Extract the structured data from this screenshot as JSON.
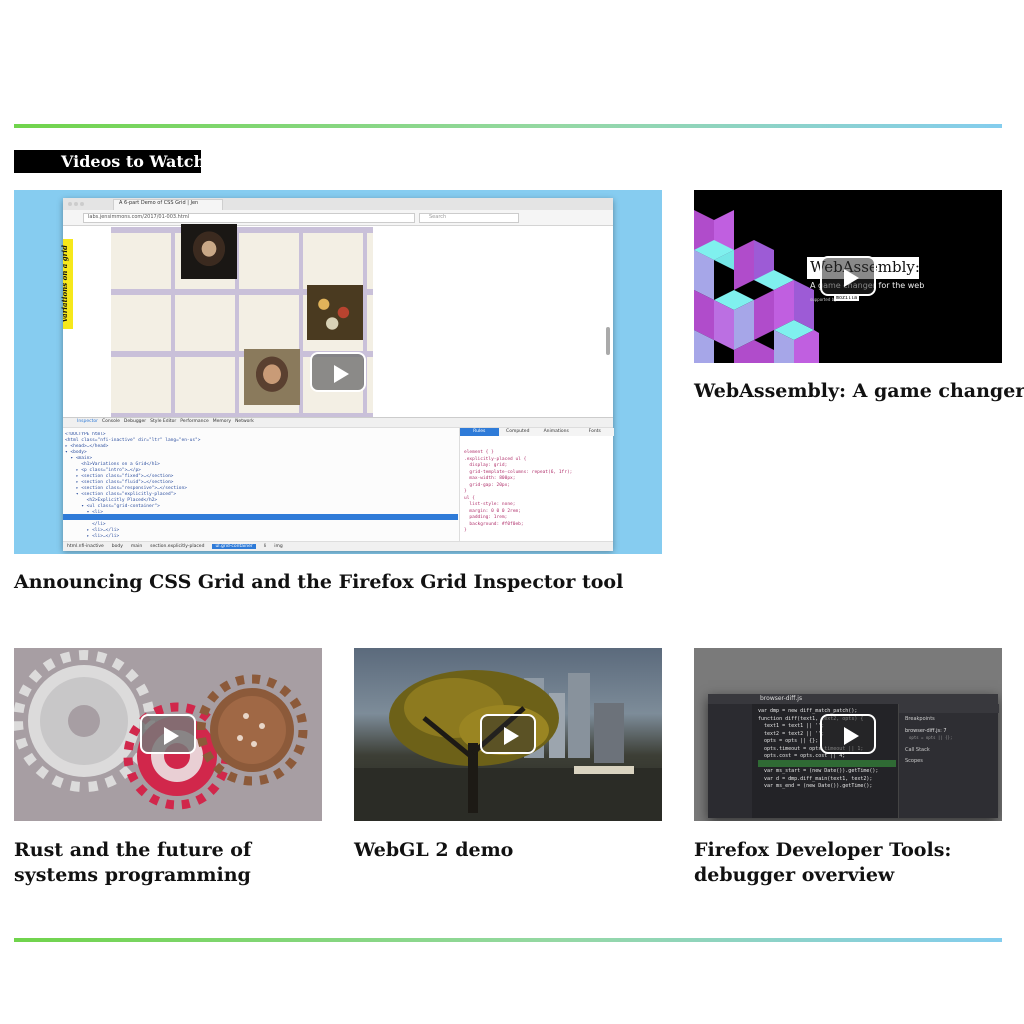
{
  "section": {
    "heading": "Videos to Watch"
  },
  "videos": [
    {
      "title": "Announcing CSS Grid and the Firefox Grid Inspector tool"
    },
    {
      "title": "WebAssembly: A game changer"
    },
    {
      "title": "Rust and the future of systems programming"
    },
    {
      "title": "WebGL 2 demo"
    },
    {
      "title": "Firefox Developer Tools: debugger overview"
    }
  ],
  "featured_screen": {
    "tab_title": "A 6-part Demo of CSS Grid | Jen",
    "url": "labs.jensimmons.com/2017/01-003.html",
    "search_placeholder": "Search",
    "sidebar_text": "variations on a grid",
    "devtools_tabs": [
      "Inspector",
      "Console",
      "Debugger",
      "Style Editor",
      "Performance",
      "Memory",
      "Network"
    ],
    "rules_tabs": [
      "Rules",
      "Computed",
      "Animations",
      "Fonts"
    ],
    "html_lines": [
      "<!DOCTYPE html>",
      "<html class=\"nfi-inactive\" dir=\"ltr\" lang=\"en-us\">",
      "▸ <head>…</head>",
      "▾ <body>",
      "  ▾ <main>",
      "      <h1>Variations on a Grid</h1>",
      "    ▸ <p class=\"intro\">…</p>",
      "    ▸ <section class=\"fixed\">…</section>",
      "    ▸ <section class=\"fluid\">…</section>",
      "    ▸ <section class=\"responsive\">…</section>",
      "    ▾ <section class=\"explicitly-placed\">",
      "        <h2>Explicitly Placed</h2>",
      "      ▾ <ul class=\"grid-container\">",
      "        ▾ <li>",
      "            <img src=\"media/01-001.jpg\" alt=\"\">",
      "          </li>",
      "        ▸ <li>…</li>",
      "        ▸ <li>…</li>"
    ],
    "css_lines": [
      "element { }",
      ".explicitly-placed ul {",
      "  display: grid;",
      "  grid-template-columns: repeat(6, 1fr);",
      "  max-width: 800px;",
      "  grid-gap: 20px;",
      "}",
      "ul {",
      "  list-style: none;",
      "  margin: 0 0 0 2rem;",
      "  padding: 1rem;",
      "  background: #f0f0eb;",
      "}"
    ],
    "breadcrumbs": [
      "html.nfi-inactive",
      "body",
      "main",
      "section.explicitly-placed",
      "ul.grid-container",
      "li",
      "img"
    ]
  },
  "webassembly_thumb": {
    "heading": "WebAssembly:",
    "subheading": "A game changer for the web",
    "supported_by": "supported by",
    "sponsor": "mozilla"
  },
  "debugger_thumb": {
    "file_tab": "browser-diff.js",
    "code_lines": [
      "var dmp = new diff_match_patch();",
      "",
      "function diff(text1, text2, opts) {",
      "  text1 = text1 || '';",
      "  text2 = text2 || '';",
      "",
      "  opts = opts || {};",
      "  opts.timeout = opts.timeout || 1;",
      "  opts.cost = opts.cost || 4;",
      "  opts.cleanup = opts.cleanup || \"semantic\";",
      "",
      "  var ms_start = (new Date()).getTime();",
      "  var d = dmp.diff_main(text1, text2);",
      "  var ms_end = (new Date()).getTime();"
    ],
    "panel_breakpoints": "Breakpoints",
    "panel_bp_item": "browser-diff.js: 7",
    "panel_bp_sub": "opts = opts || {};",
    "panel_callstack": "Call Stack",
    "panel_scopes": "Scopes"
  },
  "colors": {
    "featured_bg": "#86ccf0",
    "rule_green": "#70d44b",
    "rule_blue": "#84cdee",
    "rust_red": "#d1274b"
  }
}
